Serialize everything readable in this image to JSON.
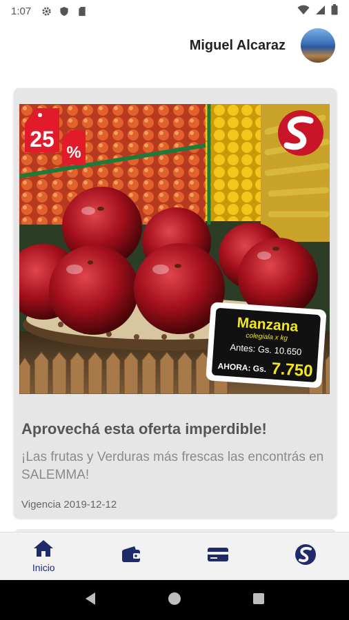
{
  "status_bar": {
    "time": "1:07"
  },
  "header": {
    "user_name": "Miguel Alcaraz"
  },
  "card": {
    "promo": {
      "discount_number": "25",
      "discount_symbol": "%",
      "price_tag": {
        "product": "Manzana",
        "subtitle": "colegiala x kg",
        "before_label": "Antes: Gs. 10.650",
        "now_label": "AHORA: Gs.",
        "now_price": "7.750"
      }
    },
    "title": "Aprovechá esta oferta imperdible!",
    "description": "¡Las frutas y Verduras más frescas las encontrás en SALEMMA!",
    "validity": "Vigencia 2019-12-12"
  },
  "bottom_nav": {
    "items": [
      {
        "label": "Inicio",
        "icon": "home-icon"
      },
      {
        "label": "",
        "icon": "wallet-icon"
      },
      {
        "label": "",
        "icon": "card-icon"
      },
      {
        "label": "",
        "icon": "salemma-logo-icon"
      }
    ]
  },
  "colors": {
    "nav_accent": "#1f2a6b",
    "tag_red": "#e21b2a",
    "price_yellow": "#f5e61a"
  }
}
